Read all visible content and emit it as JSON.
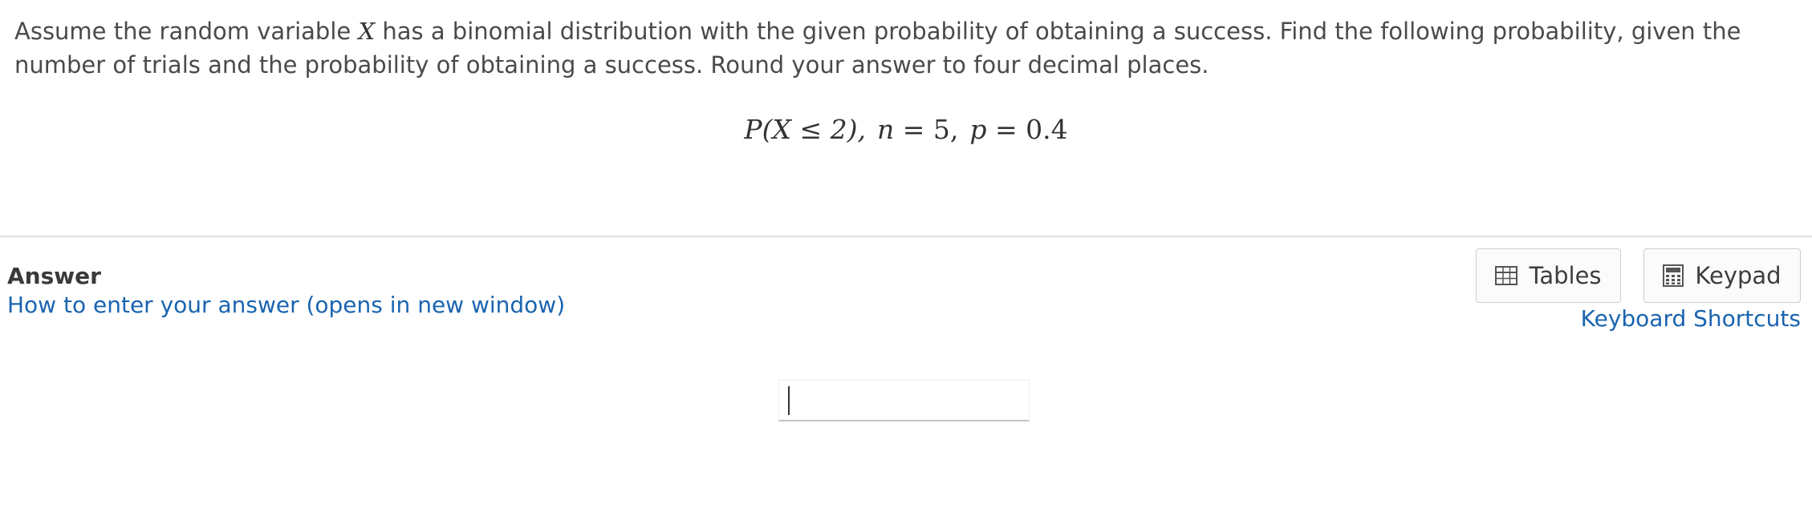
{
  "question": {
    "text_before_var": "Assume the random variable ",
    "variable": "X",
    "text_after_var": " has a binomial distribution with the given probability of obtaining a success. Find the following probability, given the number of trials and the probability of obtaining a success. Round your answer to four decimal places."
  },
  "formula": {
    "prob": "P(X ≤ 2),",
    "n_label": "n",
    "n_value": "= 5,",
    "p_label": "p",
    "p_value": "= 0.4"
  },
  "answer": {
    "label": "Answer",
    "help_link": "How to enter your answer (opens in new window)",
    "input_value": ""
  },
  "tools": {
    "tables_label": "Tables",
    "keypad_label": "Keypad",
    "shortcuts_label": "Keyboard Shortcuts"
  },
  "colors": {
    "link": "#1a64b0",
    "text": "#4a4a4a",
    "divider": "#e2e2e2"
  },
  "icons": {
    "tables": "table-grid-icon",
    "keypad": "calculator-icon"
  }
}
